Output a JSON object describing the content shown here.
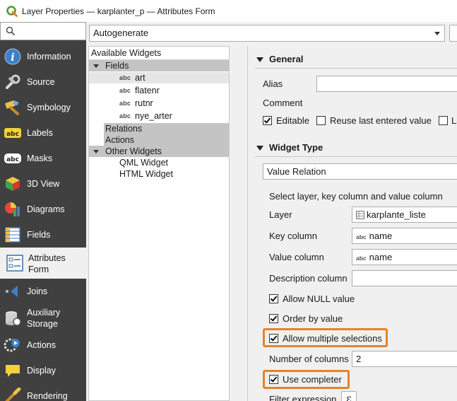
{
  "window": {
    "title": "Layer Properties — karplanter_p — Attributes Form"
  },
  "search": {
    "value": "",
    "placeholder": ""
  },
  "sidebar": {
    "items": [
      {
        "label": "Information",
        "icon": "info-icon"
      },
      {
        "label": "Source",
        "icon": "source-icon"
      },
      {
        "label": "Symbology",
        "icon": "symbology-icon"
      },
      {
        "label": "Labels",
        "icon": "labels-icon"
      },
      {
        "label": "Masks",
        "icon": "masks-icon"
      },
      {
        "label": "3D View",
        "icon": "3d-view-icon"
      },
      {
        "label": "Diagrams",
        "icon": "diagrams-icon"
      },
      {
        "label": "Fields",
        "icon": "fields-icon"
      },
      {
        "label_line1": "Attributes",
        "label_line2": "Form",
        "icon": "attributes-form-icon",
        "active": true
      },
      {
        "label": "Joins",
        "icon": "joins-icon"
      },
      {
        "label_line1": "Auxiliary",
        "label_line2": "Storage",
        "icon": "auxiliary-storage-icon"
      },
      {
        "label": "Actions",
        "icon": "actions-icon"
      },
      {
        "label": "Display",
        "icon": "display-icon"
      },
      {
        "label": "Rendering",
        "icon": "rendering-icon"
      }
    ]
  },
  "layout_mode": {
    "selected": "Autogenerate"
  },
  "widget_tree": {
    "header": "Available Widgets",
    "fields_group": "Fields",
    "fields": [
      {
        "type": "abc",
        "name": "art"
      },
      {
        "type": "abc",
        "name": "flatenr"
      },
      {
        "type": "abc",
        "name": "rutnr"
      },
      {
        "type": "abc",
        "name": "nye_arter"
      }
    ],
    "relations": "Relations",
    "actions": "Actions",
    "other_widgets": "Other Widgets",
    "others": [
      "QML Widget",
      "HTML Widget"
    ]
  },
  "general": {
    "heading": "General",
    "alias_label": "Alias",
    "alias_value": "",
    "comment_label": "Comment",
    "editable_label": "Editable",
    "editable_checked": true,
    "reuse_label": "Reuse last entered value",
    "reuse_checked": false,
    "la_label": "La"
  },
  "widget_type": {
    "heading": "Widget Type",
    "selected": "Value Relation",
    "instruction": "Select layer, key column and value column",
    "layer_label": "Layer",
    "layer_value": "karplante_liste",
    "key_label": "Key column",
    "key_value": "name",
    "value_label": "Value column",
    "value_value": "name",
    "description_label": "Description column",
    "description_value": "",
    "allow_null_label": "Allow NULL value",
    "allow_null_checked": true,
    "order_by_label": "Order by value",
    "order_by_checked": true,
    "allow_multi_label": "Allow multiple selections",
    "allow_multi_checked": true,
    "num_columns_label": "Number of columns",
    "num_columns_value": "2",
    "use_completer_label": "Use completer",
    "use_completer_checked": true,
    "filter_label": "Filter expression",
    "expression_button": "ε"
  },
  "colors": {
    "sidebar_bg": "#404040",
    "highlight": "#e5832b",
    "group_row": "#c4c4c4"
  }
}
